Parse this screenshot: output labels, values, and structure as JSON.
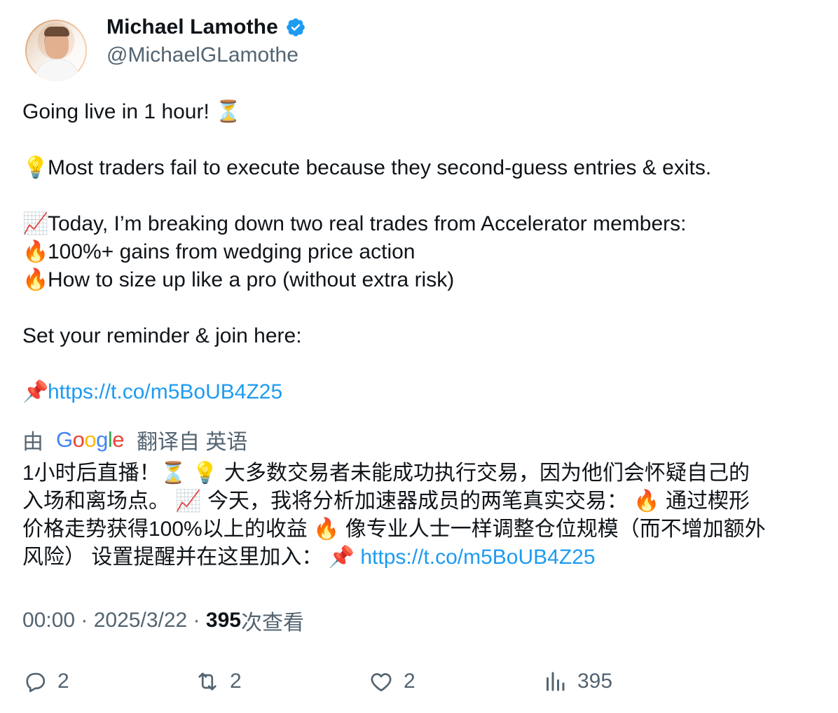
{
  "author": {
    "name": "Michael Lamothe",
    "handle": "@MichaelGLamothe",
    "verified": true
  },
  "tweet": {
    "lines": [
      {
        "emoji": "",
        "text": "Going live in 1 hour! ⏳"
      },
      {
        "emoji": "",
        "text": ""
      },
      {
        "emoji": "💡",
        "text": "Most traders fail to execute because they second-guess entries & exits."
      },
      {
        "emoji": "",
        "text": ""
      },
      {
        "emoji": "📈",
        "text": "Today, I’m breaking down two real trades from Accelerator members:"
      },
      {
        "emoji": "🔥",
        "text": "100%+ gains from wedging price action"
      },
      {
        "emoji": "🔥",
        "text": "How to size up like a pro (without extra risk)"
      },
      {
        "emoji": "",
        "text": ""
      },
      {
        "emoji": "",
        "text": "Set your reminder & join here:"
      },
      {
        "emoji": "",
        "text": ""
      }
    ],
    "link_emoji": "📌",
    "link": "https://t.co/m5BoUB4Z25"
  },
  "translation": {
    "prefix": "由",
    "brand": [
      "G",
      "o",
      "o",
      "g",
      "l",
      "e"
    ],
    "suffix": "翻译自 英语",
    "lines": [
      "1小时后直播！⏳ 💡 大多数交易者未能成功执行交易，因为他们会怀疑自己的",
      "入场和离场点。 📈 今天，我将分析加速器成员的两笔真实交易： 🔥 通过楔形",
      "价格走势获得100%以上的收益 🔥 像专业人士一样调整仓位规模（而不增加额外",
      "风险） 设置提醒并在这里加入： 📌 "
    ],
    "link": "https://t.co/m5BoUB4Z25"
  },
  "meta": {
    "time": "00:00",
    "sep1": " · ",
    "date": "2025/3/22",
    "sep2": " · ",
    "views": "395",
    "views_label": "次查看"
  },
  "actions": {
    "reply_count": "2",
    "retweet_count": "2",
    "like_count": "2",
    "views_count": "395"
  },
  "colors": {
    "link": "#1d9bf0",
    "muted": "#536471",
    "text": "#0f1419",
    "verified": "#1d9bf0"
  },
  "icons": [
    "verified-badge-icon",
    "reply-icon",
    "retweet-icon",
    "like-icon",
    "views-icon"
  ]
}
